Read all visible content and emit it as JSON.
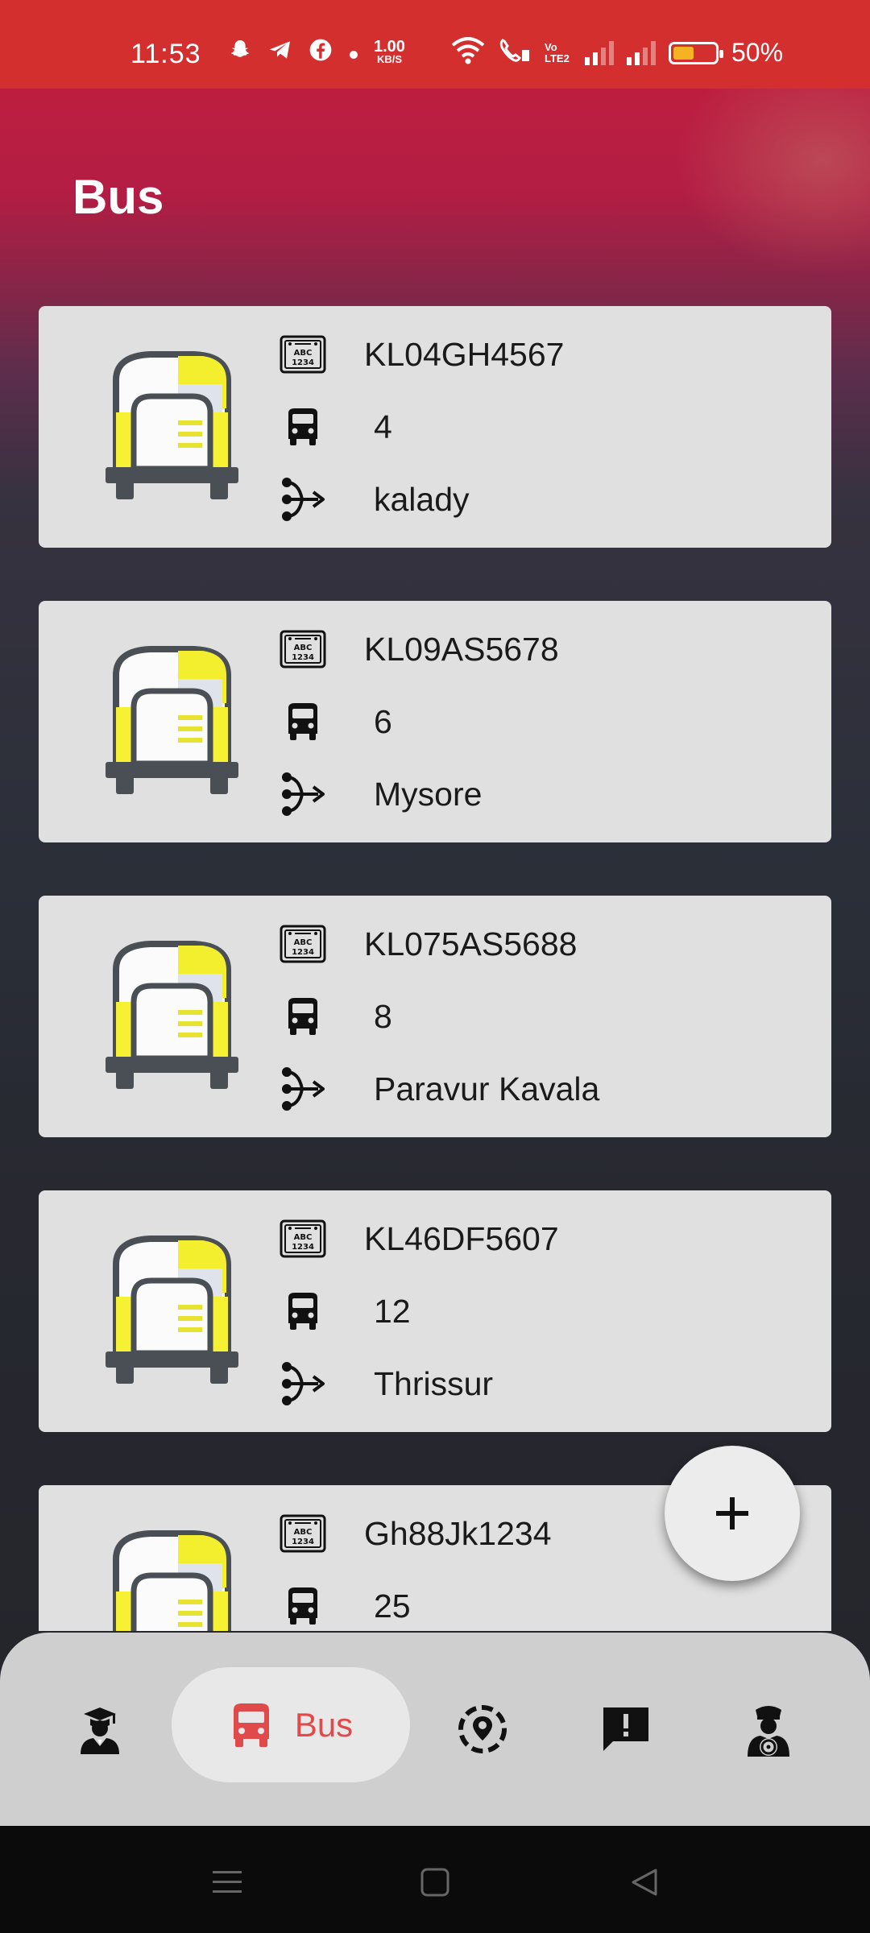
{
  "status_bar": {
    "time": "11:53",
    "net_speed_value": "1.00",
    "net_speed_unit": "KB/S",
    "volte_label": "Vo LTE2",
    "battery_percent": "50%",
    "battery_level": 0.5,
    "icons": [
      "snapchat-icon",
      "telegram-icon",
      "facebook-icon",
      "dot-icon",
      "wifi-icon",
      "wifi-call-icon",
      "signal-icon",
      "signal-icon",
      "battery-icon"
    ]
  },
  "page": {
    "title": "Bus"
  },
  "buses": [
    {
      "registration": "KL04GH4567",
      "bus_number": "4",
      "route": "kalady"
    },
    {
      "registration": "KL09AS5678",
      "bus_number": "6",
      "route": "Mysore"
    },
    {
      "registration": "KL075AS5688",
      "bus_number": "8",
      "route": "Paravur Kavala"
    },
    {
      "registration": "KL46DF5607",
      "bus_number": "12",
      "route": "Thrissur"
    },
    {
      "registration": "Gh88Jk1234",
      "bus_number": "25",
      "route": ""
    }
  ],
  "fab": {
    "icon": "plus-icon"
  },
  "bottom_nav": {
    "items": [
      {
        "icon": "student-icon",
        "label": ""
      },
      {
        "icon": "bus-icon",
        "label": "Bus",
        "active": true
      },
      {
        "icon": "location-icon",
        "label": ""
      },
      {
        "icon": "feedback-icon",
        "label": ""
      },
      {
        "icon": "driver-icon",
        "label": ""
      }
    ]
  },
  "system_nav": {
    "icons": [
      "menu-icon",
      "home-icon",
      "back-icon"
    ]
  },
  "colors": {
    "status_bar": "#d32f2f",
    "card": "#e0e0e0",
    "nav_bar": "#cfcfcf",
    "accent": "#e04a4a"
  }
}
